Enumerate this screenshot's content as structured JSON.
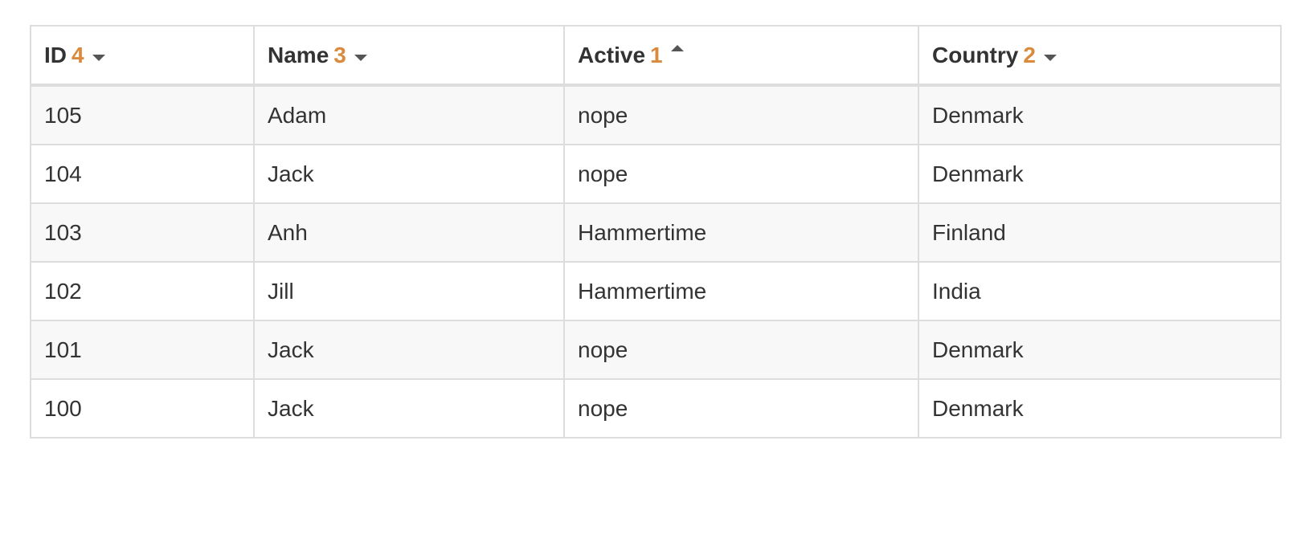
{
  "table": {
    "columns": [
      {
        "label": "ID",
        "sort_rank": "4",
        "sort_direction": "desc",
        "icon": "caret-down-icon"
      },
      {
        "label": "Name",
        "sort_rank": "3",
        "sort_direction": "desc",
        "icon": "caret-down-icon"
      },
      {
        "label": "Active",
        "sort_rank": "1",
        "sort_direction": "asc",
        "icon": "caret-up-icon"
      },
      {
        "label": "Country",
        "sort_rank": "2",
        "sort_direction": "desc",
        "icon": "caret-down-icon"
      }
    ],
    "rows": [
      [
        "105",
        "Adam",
        "nope",
        "Denmark"
      ],
      [
        "104",
        "Jack",
        "nope",
        "Denmark"
      ],
      [
        "103",
        "Anh",
        "Hammertime",
        "Finland"
      ],
      [
        "102",
        "Jill",
        "Hammertime",
        "India"
      ],
      [
        "101",
        "Jack",
        "nope",
        "Denmark"
      ],
      [
        "100",
        "Jack",
        "nope",
        "Denmark"
      ]
    ]
  },
  "colors": {
    "sort_rank": "#d98a3d",
    "text": "#333333",
    "border": "#dddddd",
    "stripe": "#f8f8f8"
  }
}
